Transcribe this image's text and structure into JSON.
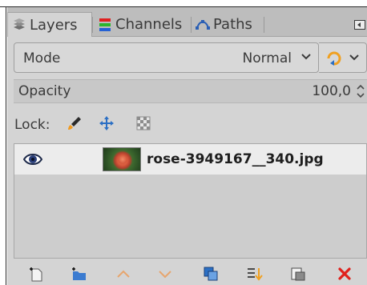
{
  "tabs": [
    {
      "label": "Layers",
      "icon": "layers-icon",
      "active": true
    },
    {
      "label": "Channels",
      "icon": "channels-icon",
      "active": false
    },
    {
      "label": "Paths",
      "icon": "paths-icon",
      "active": false
    }
  ],
  "mode": {
    "label": "Mode",
    "value": "Normal"
  },
  "opacity": {
    "label": "Opacity",
    "value": "100,0"
  },
  "lock": {
    "label": "Lock:"
  },
  "layers": [
    {
      "name": "rose-3949167__340.jpg",
      "visible": true
    }
  ],
  "toolbar": [
    "new-layer-icon",
    "new-layer-group-icon",
    "raise-layer-icon",
    "lower-layer-icon",
    "duplicate-layer-icon",
    "anchor-merge-icon",
    "mask-icon",
    "delete-layer-icon"
  ],
  "colors": {
    "panel": "#d4d4d4",
    "tabbar": "#bdbdbd",
    "selected_row": "#ececec",
    "delete": "#e0201b",
    "move_icon": "#2b6fc4"
  }
}
